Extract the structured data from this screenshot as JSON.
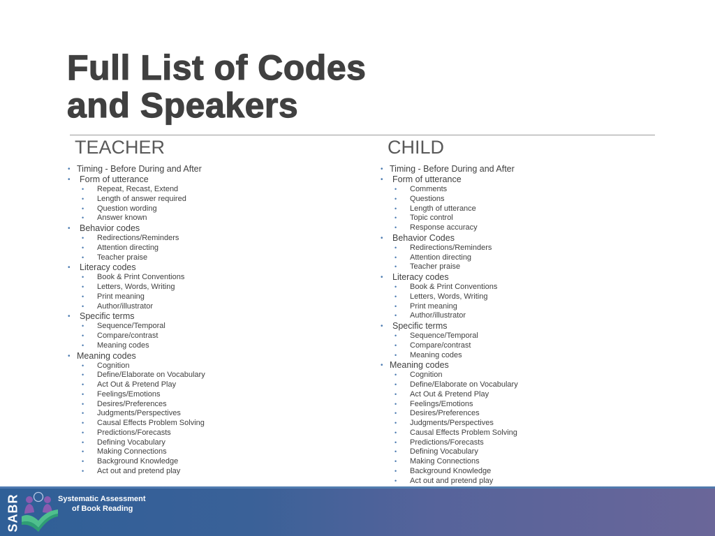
{
  "title": {
    "line1": "Full List of Codes",
    "line2": "and Speakers"
  },
  "teacher": {
    "heading": "TEACHER",
    "items": [
      {
        "label": "Timing - Before During and After",
        "children": []
      },
      {
        "label": "Form of utterance",
        "children": [
          "Repeat, Recast, Extend",
          "Length of answer required",
          "Question wording",
          "Answer known"
        ]
      },
      {
        "label": "Behavior codes",
        "children": [
          "Redirections/Reminders",
          "Attention directing",
          "Teacher praise"
        ]
      },
      {
        "label": "Literacy codes",
        "children": [
          "Book & Print Conventions",
          "Letters, Words, Writing",
          "Print meaning",
          "Author/illustrator"
        ]
      },
      {
        "label": "Specific terms",
        "children": [
          "Sequence/Temporal",
          "Compare/contrast",
          "Meaning codes"
        ]
      },
      {
        "label": "Meaning codes",
        "children": [
          "Cognition",
          "Define/Elaborate on Vocabulary",
          "Act Out & Pretend Play",
          "Feelings/Emotions",
          "Desires/Preferences",
          "Judgments/Perspectives",
          "Causal Effects Problem Solving",
          "Predictions/Forecasts",
          "Defining Vocabulary",
          "Making Connections",
          "Background Knowledge",
          "Act out and pretend play"
        ]
      }
    ]
  },
  "child": {
    "heading": "CHILD",
    "items": [
      {
        "label": "Timing - Before During and After",
        "children": []
      },
      {
        "label": "Form of utterance",
        "children": [
          "Comments",
          "Questions",
          "Length of utterance",
          "Topic control",
          "Response accuracy"
        ]
      },
      {
        "label": "Behavior Codes",
        "children": [
          "Redirections/Reminders",
          "Attention directing",
          "Teacher praise"
        ]
      },
      {
        "label": "Literacy codes",
        "children": [
          "Book & Print Conventions",
          "Letters, Words, Writing",
          "Print meaning",
          "Author/illustrator"
        ]
      },
      {
        "label": "Specific terms",
        "children": [
          "Sequence/Temporal",
          "Compare/contrast",
          "Meaning codes"
        ]
      },
      {
        "label": "Meaning codes",
        "children": [
          "Cognition",
          "Define/Elaborate on Vocabulary",
          "Act Out & Pretend Play",
          "Feelings/Emotions",
          "Desires/Preferences",
          "Judgments/Perspectives",
          "Causal Effects Problem Solving",
          "Predictions/Forecasts",
          "Defining Vocabulary",
          "Making Connections",
          "Background Knowledge",
          "Act out and pretend play"
        ]
      }
    ]
  },
  "footer": {
    "logo_abbrev": "SABR",
    "logo_line1": "Systematic Assessment",
    "logo_line2": "of Book Reading",
    "colors": {
      "band_left": "#2f5f97",
      "band_right": "#6a6699",
      "book_green": "#4fc08d",
      "figure_purple": "#8a5bb0"
    }
  },
  "bullet_color": "#4a7ab0"
}
